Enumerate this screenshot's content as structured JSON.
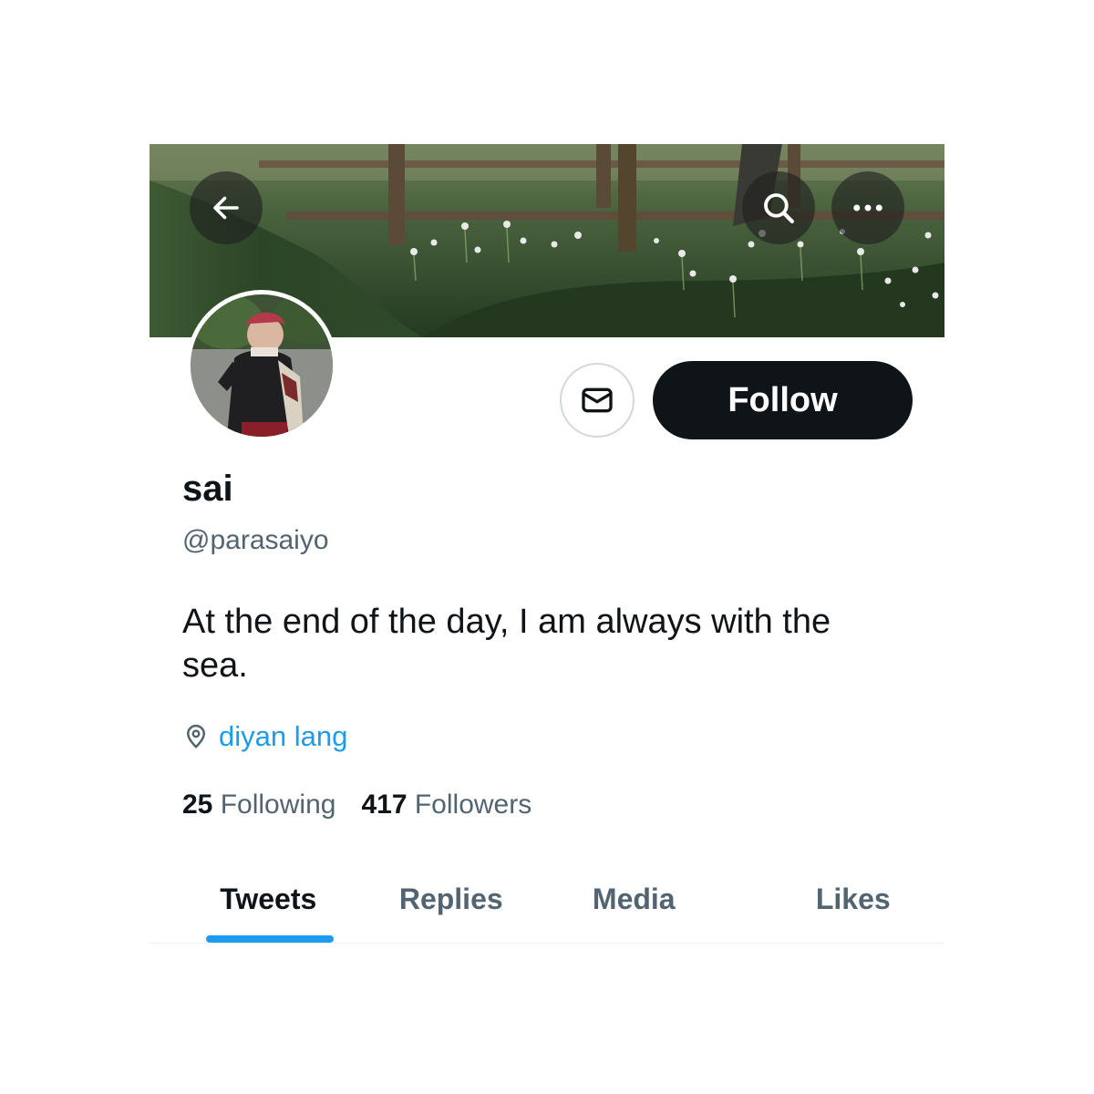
{
  "header": {
    "back_icon": "arrow-left-icon",
    "search_icon": "search-icon",
    "more_icon": "more-horizontal-icon",
    "banner_description_colors": {
      "grass": "#2f4a2a",
      "fence": "#6b5a45",
      "flowers": "#f2f2f2"
    }
  },
  "profile": {
    "display_name": "sai",
    "handle": "@parasaiyo",
    "bio": "At the end of the day, I am always with the sea.",
    "location": "diyan lang",
    "location_icon": "location-pin-icon"
  },
  "actions": {
    "message_icon": "envelope-icon",
    "follow_label": "Follow"
  },
  "stats": {
    "following_count": "25",
    "following_label": "Following",
    "followers_count": "417",
    "followers_label": "Followers"
  },
  "tabs": [
    {
      "label": "Tweets",
      "active": true
    },
    {
      "label": "Replies",
      "active": false
    },
    {
      "label": "Media",
      "active": false
    },
    {
      "label": "Likes",
      "active": false
    }
  ],
  "colors": {
    "accent": "#1d9bf0",
    "text_primary": "#0f1419",
    "text_secondary": "#536471",
    "follow_bg": "#0f1419"
  }
}
